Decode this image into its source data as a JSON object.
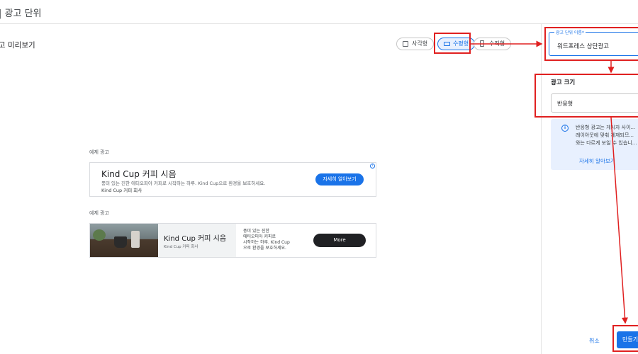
{
  "header": {
    "title": "| 광고 단위"
  },
  "preview": {
    "title": "고 미리보기",
    "formats": [
      {
        "label": "사각형",
        "icon": "square-icon"
      },
      {
        "label": "수평형",
        "icon": "horizontal-rect-icon"
      },
      {
        "label": "수직형",
        "icon": "vertical-rect-icon"
      }
    ],
    "selected_format": "수평형"
  },
  "samples": [
    {
      "label": "예제 광고",
      "title": "Kind Cup 커피 시음",
      "description": "풍미 있는 진한 에티오피아 커피로 시작하는 하루. Kind Cup으로 환경을 보호하세요.",
      "advertiser": "Kind Cup 커피 회사",
      "cta": "자세히 알아보기"
    },
    {
      "label": "예제 광고",
      "title": "Kind Cup 커피 시음",
      "advertiser": "Kind Cup 커피 회사",
      "description_lines": [
        "풍미 있는 진한",
        "에티오피아 커피로",
        "시작하는 하루. Kind Cup",
        "으로 환경을 보호하세요."
      ],
      "cta": "More"
    }
  ],
  "panel": {
    "name_label": "광고 단위 이름*",
    "name_value": "워드프레스 상단광고",
    "size_title": "광고 크기",
    "size_value": "반응형",
    "info_lines": [
      "반응형 광고는 게시자 사이...",
      "레이아웃에 맞춰 게재되므...",
      "와는 다르게 보일 수 있습니..."
    ],
    "info_link": "자세히 알아보기",
    "cancel": "취소",
    "create": "만들기"
  },
  "colors": {
    "accent": "#1a73e8",
    "highlight": "#e02020"
  }
}
